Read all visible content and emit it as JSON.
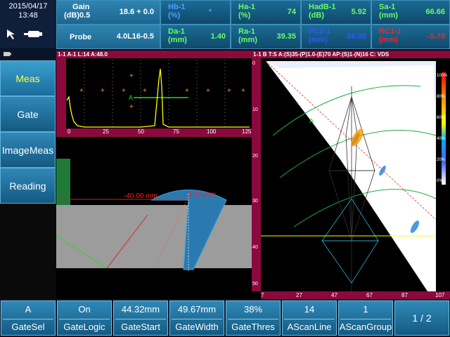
{
  "datetime": {
    "date": "2015/04/17",
    "time": "13:48"
  },
  "readings": {
    "gain": {
      "label1": "Gain",
      "label2": "(dB)0.5",
      "value": "18.6 + 0.0"
    },
    "probe": {
      "label": "Probe",
      "value": "4.0L16-0.5"
    },
    "hb": {
      "label1": "Hb-1",
      "label2": "(%)",
      "value": "*"
    },
    "ha": {
      "label1": "Ha-1",
      "label2": "(%)",
      "value": "74"
    },
    "hadb": {
      "label1": "HadB-1",
      "label2": "(dB)",
      "value": "5.92"
    },
    "sa": {
      "label1": "Sa-1",
      "label2": "(mm)",
      "value": "66.66"
    },
    "da": {
      "label1": "Da-1",
      "label2": "(mm)",
      "value": "1.40"
    },
    "ra": {
      "label1": "Ra-1",
      "label2": "(mm)",
      "value": "39.35"
    },
    "pc": {
      "label1": "PC2-1",
      "label2": "(mm)",
      "value": "56.89"
    },
    "rc": {
      "label1": "RC1-1",
      "label2": "(mm)",
      "value": "-5.75"
    }
  },
  "colors": {
    "hb": "#4aa0ff",
    "ha": "#66ff66",
    "hadb": "#66ff66",
    "sa": "#66ff66",
    "da": "#66ff66",
    "ra": "#66ff66",
    "pc": "#3355ff",
    "rc": "#ff2222",
    "gain": "#ffffff",
    "probe": "#ffffff"
  },
  "side_menu": [
    "Meas",
    "Gate",
    "ImageMeas",
    "Reading"
  ],
  "ascan": {
    "header": "1-1 A-1  L:14  A:48.0",
    "ticks": [
      "0",
      "25",
      "50",
      "75",
      "100",
      "125"
    ],
    "gate_label": "A"
  },
  "sector": {
    "header": "1-1 B  T:S A:(S)35-(P)1.0-(E)70 AP:(S)1-(N)16 C: VDS",
    "xticks": [
      "7",
      "27",
      "47",
      "67",
      "87",
      "107"
    ],
    "yticks": [
      "0",
      "10",
      "20",
      "30",
      "40",
      "50"
    ],
    "scale": [
      "100%",
      "80%",
      "60%",
      "40%",
      "20%",
      "0%"
    ],
    "gate_label": "A"
  },
  "weld": {
    "dim1": "-40.00 mm",
    "dim2": "1.40 mm"
  },
  "bottom": [
    {
      "value": "A",
      "name": "GateSel"
    },
    {
      "value": "On",
      "name": "GateLogic"
    },
    {
      "value": "44.32mm",
      "name": "GateStart"
    },
    {
      "value": "49.67mm",
      "name": "GateWidth"
    },
    {
      "value": "38%",
      "name": "GateThres"
    },
    {
      "value": "14",
      "name": "AScanLine"
    },
    {
      "value": "1",
      "name": "AScanGroup"
    }
  ],
  "page": "1 / 2"
}
